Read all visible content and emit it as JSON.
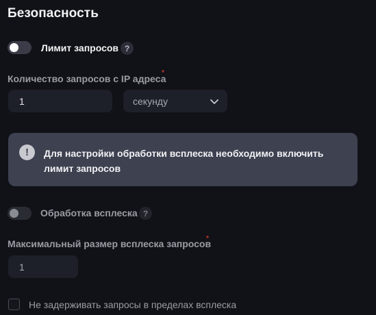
{
  "section_title": "Безопасность",
  "rate_limit": {
    "toggle_label": "Лимит запросов",
    "help_glyph": "?",
    "enabled": false
  },
  "requests_per_ip": {
    "label": "Количество запросов с IP адреса",
    "required_mark": "*",
    "value": "1",
    "unit_select": "секунду"
  },
  "alert": {
    "icon_glyph": "!",
    "text": "Для настройки обработки всплеска необходимо включить лимит запросов"
  },
  "burst": {
    "toggle_label": "Обработка всплеска",
    "help_glyph": "?",
    "enabled": false,
    "size_label": "Максимальный размер всплеска запросов",
    "required_mark": "*",
    "size_value": "1",
    "nodelay_label": "Не задерживать запросы в пределах всплеска",
    "nodelay_checked": false
  },
  "colors": {
    "background": "#111217",
    "input_bg": "#1e2029",
    "alert_bg": "#3d4150",
    "required": "#c0392b"
  }
}
